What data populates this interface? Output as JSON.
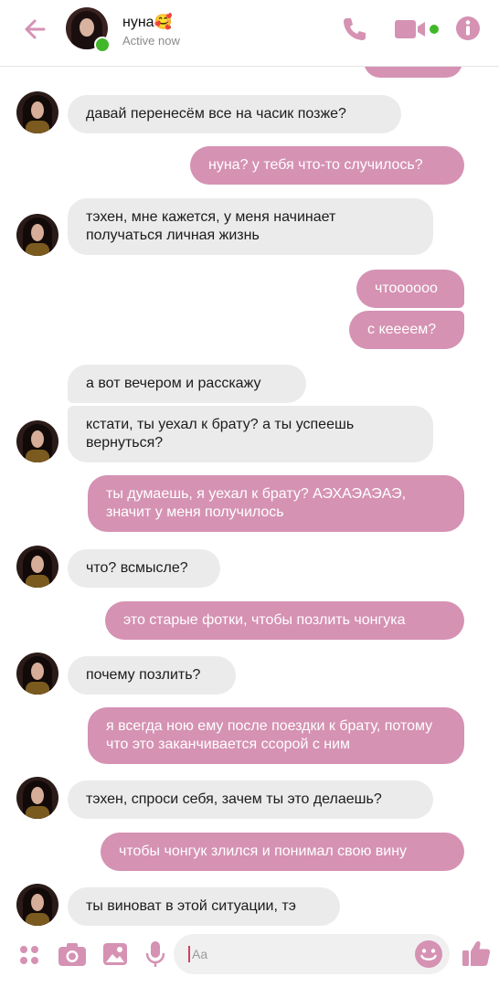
{
  "header": {
    "contact_name": "нуна",
    "contact_emoji": "🥰",
    "status": "Active now",
    "icons": [
      "back-arrow-icon",
      "phone-icon",
      "video-camera-icon",
      "info-icon"
    ],
    "accent": "#d592b3"
  },
  "messages": [
    {
      "dir": "in",
      "text": "давай перенесём все на часик позже?"
    },
    {
      "dir": "out",
      "text": "нуна? у тебя что-то случилось?"
    },
    {
      "dir": "in",
      "text": "тэхен, мне кажется, у меня начинает получаться личная жизнь"
    },
    {
      "dir": "out",
      "text": "чтоооооо"
    },
    {
      "dir": "out",
      "text": "с кеееем?"
    },
    {
      "dir": "in",
      "text": "а вот вечером и расскажу"
    },
    {
      "dir": "in",
      "text": "кстати, ты уехал к брату? а ты успеешь вернуться?"
    },
    {
      "dir": "out",
      "text": "ты думаешь, я уехал к брату? АЭХАЭАЭАЭ, значит у меня получилось"
    },
    {
      "dir": "in",
      "text": "что? всмысле?"
    },
    {
      "dir": "out",
      "text": "это старые фотки, чтобы позлить чонгука"
    },
    {
      "dir": "in",
      "text": "почему позлить?"
    },
    {
      "dir": "out",
      "text": "я всегда ною ему после поездки к брату, потому что это заканчивается ссорой с ним"
    },
    {
      "dir": "in",
      "text": "тэхен, спроси себя, зачем ты это делаешь?"
    },
    {
      "dir": "out",
      "text": "чтобы чонгук злился и понимал свою вину"
    },
    {
      "dir": "in",
      "text": "ты виноват в этой ситуации, тэ"
    }
  ],
  "composer": {
    "placeholder": "Aa",
    "icons": [
      "apps-icon",
      "camera-icon",
      "image-icon",
      "microphone-icon",
      "emoji-icon",
      "thumbs-up-icon"
    ]
  }
}
